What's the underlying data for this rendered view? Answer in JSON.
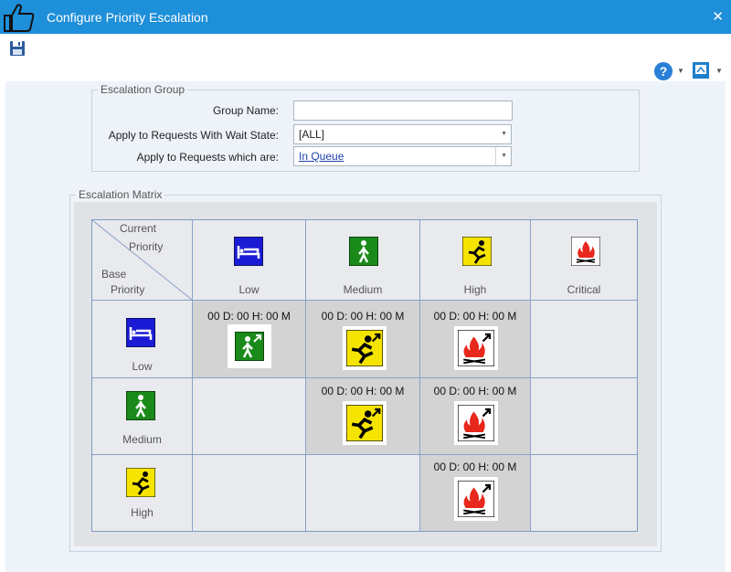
{
  "window": {
    "title": "Configure Priority Escalation",
    "close_glyph": "✕",
    "icon": "thumbs-up-icon"
  },
  "toolbar": {
    "save_icon": "floppy-disk-icon",
    "help_glyph": "?",
    "dropdown_glyph": "▼"
  },
  "escalation_group": {
    "legend": "Escalation Group",
    "group_name_label": "Group Name:",
    "group_name_value": "",
    "wait_state_label": "Apply to Requests With Wait State:",
    "wait_state_value": "[ALL]",
    "requests_label": "Apply to Requests which are:",
    "requests_value": "In Queue"
  },
  "escalation_matrix": {
    "legend": "Escalation Matrix",
    "corner": {
      "top": "Current\nPriority",
      "current": "Current",
      "priority_top": "Priority",
      "base": "Base",
      "priority_bottom": "Priority"
    },
    "columns": [
      "Low",
      "Medium",
      "High",
      "Critical"
    ],
    "rows": [
      "Low",
      "Medium",
      "High"
    ],
    "cells": {
      "low_medium": "00 D: 00 H: 00 M",
      "low_high": "00 D: 00 H: 00 M",
      "low_critical": "00 D: 00 H: 00 M",
      "medium_high": "00 D: 00 H: 00 M",
      "medium_critical": "00 D: 00 H: 00 M",
      "high_critical": "00 D: 00 H: 00 M"
    },
    "colors": {
      "low": "#1b1bd6",
      "medium": "#1a8a1a",
      "high": "#f5e400",
      "critical": "#e8281c",
      "grid_line": "#8aa1c9",
      "active_cell": "#d3d3d3"
    }
  }
}
